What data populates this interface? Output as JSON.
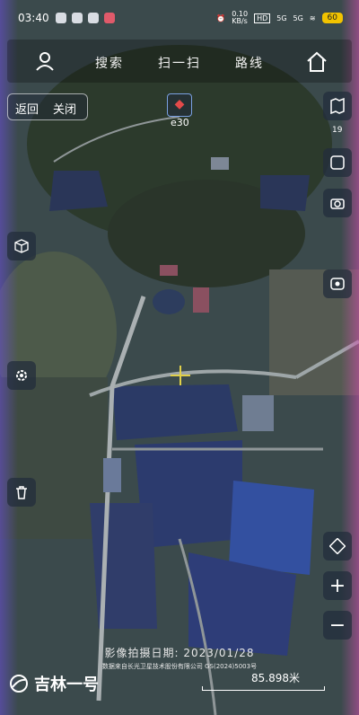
{
  "status": {
    "time": "03:40",
    "net1": "0.10\nKB/s",
    "hd": "HD",
    "sig1": "5G",
    "sig2": "5G",
    "battery": "60"
  },
  "nav": {
    "search": "搜索",
    "scan": "扫一扫",
    "route": "路线"
  },
  "controls": {
    "back": "返回",
    "close": "关闭",
    "compass_deg": "e30",
    "layer_count": "19"
  },
  "footer": {
    "capture_date": "影像拍摄日期: 2023/01/28",
    "credit": "数据来自长光卫星技术股份有限公司 GS(2024)5003号",
    "brand": "吉林一号",
    "scale": "85.898米"
  },
  "icons": {
    "user": "user-icon",
    "home": "home-icon",
    "book": "map-book-icon",
    "frame": "screenshot-frame-icon",
    "camera": "camera-icon",
    "cube": "3d-cube-icon",
    "record": "record-icon",
    "settings": "settings-gear-icon",
    "trash": "trash-icon",
    "layers": "layers-icon",
    "zoomin": "zoom-in-icon",
    "zoomout": "zoom-out-icon"
  }
}
